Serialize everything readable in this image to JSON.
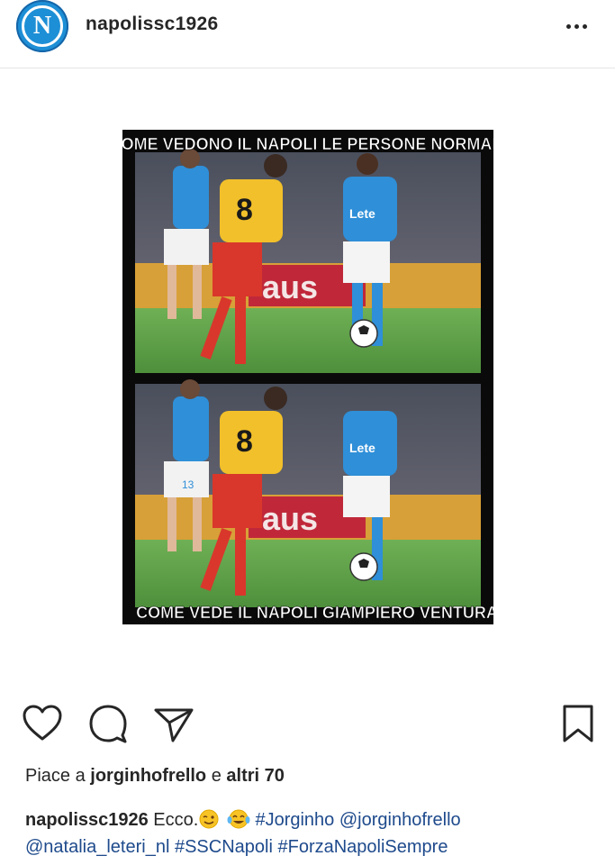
{
  "post": {
    "username": "napolissc1926",
    "avatar_letter": "N"
  },
  "meme": {
    "top_caption": "COME VEDONO IL NAPOLI LE PERSONE NORMALI",
    "bottom_caption": "COME VEDE IL NAPOLI GIAMPIERO VENTURA",
    "sponsor_text": "Lete",
    "left_player_number": "8",
    "background_player_number": "13",
    "banner_text": "aus"
  },
  "actions": {
    "icons": [
      "heart-icon",
      "comment-icon",
      "share-icon",
      "bookmark-icon"
    ]
  },
  "likes": {
    "prefix": "Piace a ",
    "user": "jorginhofrello",
    "middle": " e ",
    "others": "altri 70"
  },
  "caption": {
    "username": "napolissc1926",
    "text": " Ecco.",
    "emoji_1": "winking-face",
    "emoji_2": "face-with-tears-of-joy",
    "tags": [
      "#Jorginho",
      "@jorginhofrello",
      "@natalia_leteri_nl",
      "#SSCNapoli",
      "#ForzaNapoliSempre"
    ]
  },
  "colors": {
    "link": "#1e4a8c",
    "napoli_blue": "#2f8fd8",
    "benevento_yellow": "#f2c02a",
    "benevento_red": "#d9372b",
    "pitch_green": "#5fa14a"
  }
}
